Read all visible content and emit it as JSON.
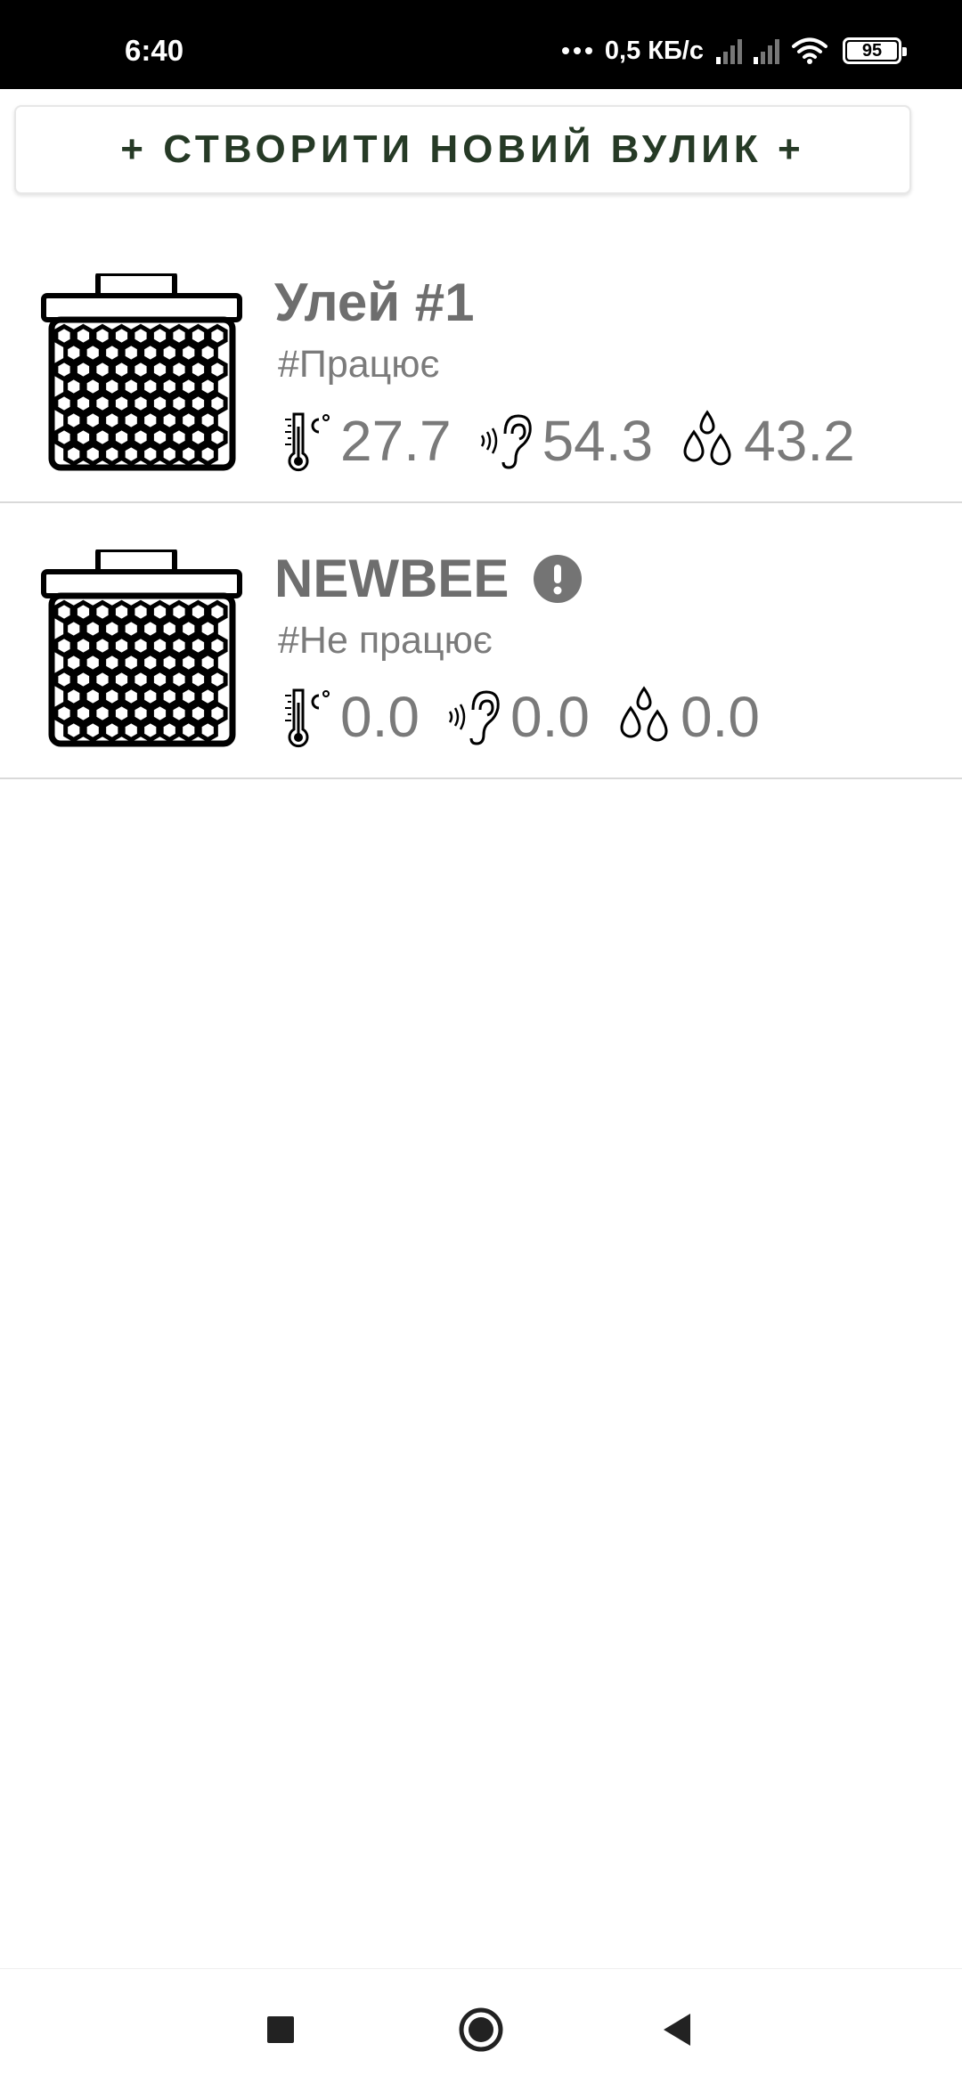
{
  "status_bar": {
    "time": "6:40",
    "network_speed": "0,5 КБ/с",
    "battery_level": "95",
    "icons": [
      "more-dots-icon",
      "signal-1-icon",
      "signal-2-icon",
      "wifi-icon",
      "battery-icon"
    ]
  },
  "create_button": {
    "label": "+ СТВОРИТИ НОВИЙ ВУЛИК +"
  },
  "hives": [
    {
      "name": "Улей #1",
      "status": "#Працює",
      "alert": false,
      "temperature": "27.7",
      "sound": "54.3",
      "humidity": "43.2"
    },
    {
      "name": "NEWBEE",
      "status": "#Не працює",
      "alert": true,
      "temperature": "0.0",
      "sound": "0.0",
      "humidity": "0.0"
    }
  ],
  "icons": {
    "hive": "beehive-icon",
    "temperature": "thermometer-icon",
    "sound": "ear-sound-icon",
    "humidity": "water-drops-icon",
    "alert": "exclamation-circle-icon"
  },
  "nav_bar": {
    "recent": "square-recent-apps-icon",
    "home": "circle-home-icon",
    "back": "triangle-back-icon"
  },
  "colors": {
    "status_bar_background": "#000000",
    "button_text": "#263a26",
    "title_text": "#6e6e6e",
    "secondary_text": "#7a7a7a",
    "divider": "#d9d9d9",
    "alert": "#7b7b7b"
  }
}
